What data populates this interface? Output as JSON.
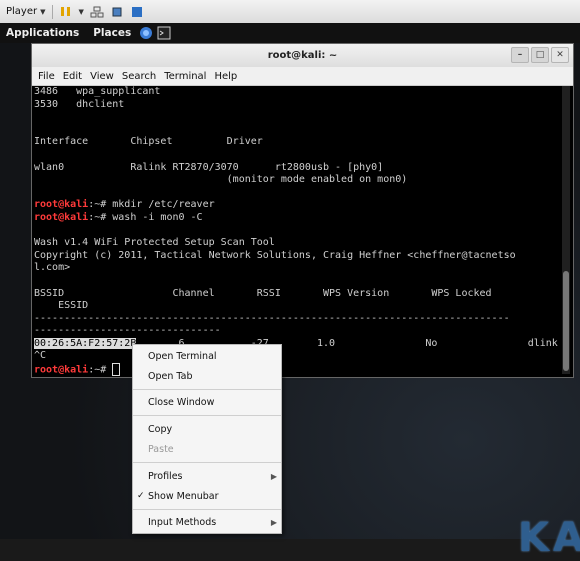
{
  "player_bar": {
    "label": "Player"
  },
  "top_panel": {
    "applications": "Applications",
    "places": "Places"
  },
  "window": {
    "title": "root@kali: ~"
  },
  "menubar": [
    "File",
    "Edit",
    "View",
    "Search",
    "Terminal",
    "Help"
  ],
  "terminal": {
    "lines": [
      "3486   wpa_supplicant",
      "3530   dhclient",
      "",
      "",
      "Interface       Chipset         Driver",
      "",
      "wlan0           Ralink RT2870/3070      rt2800usb - [phy0]",
      "                                (monitor mode enabled on mon0)",
      "",
      "",
      "",
      "",
      "Wash v1.4 WiFi Protected Setup Scan Tool",
      "Copyright (c) 2011, Tactical Network Solutions, Craig Heffner <cheffner@tacnetso",
      "l.com>",
      "",
      "BSSID                  Channel       RSSI       WPS Version       WPS Locked",
      "    ESSID",
      "-------------------------------------------------------------------------------",
      "-------------------------------",
      "00:26:5A:F2:57:2B       6           -27        1.0               No               dlink",
      "^C"
    ],
    "prompt_user": "root@kali",
    "cmd1": ":~# mkdir /etc/reaver",
    "cmd2": ":~# wash -i mon0 -C",
    "cmd3": ":~# "
  },
  "context_menu": {
    "open_terminal": "Open Terminal",
    "open_tab": "Open Tab",
    "close_window": "Close Window",
    "copy": "Copy",
    "paste": "Paste",
    "profiles": "Profiles",
    "show_menubar": "Show Menubar",
    "input_methods": "Input Methods"
  },
  "desktop": {
    "logo_text": "KA"
  }
}
